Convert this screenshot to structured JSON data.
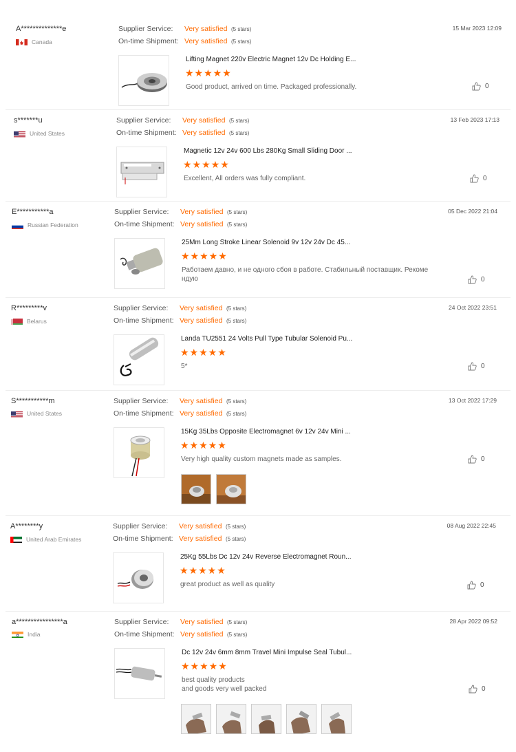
{
  "labels": {
    "supplier": "Supplier Service:",
    "shipment": "On-time Shipment:"
  },
  "reviews": [
    {
      "user": "A**************e",
      "country": "Canada",
      "supplier_val": "Very satisfied",
      "supplier_stars": "(5 stars)",
      "shipment_val": "Very satisfied",
      "shipment_stars": "(5 stars)",
      "date": "15 Mar 2023 12:09",
      "title": "Lifting Magnet 220v Electric Magnet 12v Dc Holding E...",
      "stars": "★★★★★",
      "feedback": "Good product, arrived on time. Packaged professionally.",
      "likes": "0"
    },
    {
      "user": "s*******u",
      "country": "United States",
      "supplier_val": "Very satisfied",
      "supplier_stars": "(5 stars)",
      "shipment_val": "Very satisfied",
      "shipment_stars": "(5 stars)",
      "date": "13 Feb 2023 17:13",
      "title": "Magnetic 12v 24v 600 Lbs 280Kg Small Sliding Door ...",
      "stars": "★★★★★",
      "feedback": "Excellent, All orders was fully compliant.",
      "likes": "0"
    },
    {
      "user": "E***********a",
      "country": "Russian Federation",
      "supplier_val": "Very satisfied",
      "supplier_stars": "(5 stars)",
      "shipment_val": "Very satisfied",
      "shipment_stars": "(5 stars)",
      "date": "05 Dec 2022 21:04",
      "title": "25Mm Long Stroke Linear Solenoid 9v 12v 24v Dc 45...",
      "stars": "★★★★★",
      "feedback": "Работаем давно, и не одного сбоя в работе. Стабильный поставщик. Рекоме ндую",
      "likes": "0"
    },
    {
      "user": "R*********v",
      "country": "Belarus",
      "supplier_val": "Very satisfied",
      "supplier_stars": "(5 stars)",
      "shipment_val": "Very satisfied",
      "shipment_stars": "(5 stars)",
      "date": "24 Oct 2022 23:51",
      "title": "Landa TU2551 24 Volts Pull Type Tubular Solenoid Pu...",
      "stars": "★★★★★",
      "feedback": "5*",
      "likes": "0"
    },
    {
      "user": "S***********m",
      "country": "United States",
      "supplier_val": "Very satisfied",
      "supplier_stars": "(5 stars)",
      "shipment_val": "Very satisfied",
      "shipment_stars": "(5 stars)",
      "date": "13 Oct 2022 17:29",
      "title": "15Kg 35Lbs Opposite Electromagnet 6v 12v 24v Mini ...",
      "stars": "★★★★★",
      "feedback": "Very high quality custom magnets made as samples.",
      "likes": "0"
    },
    {
      "user": "A********y",
      "country": "United Arab Emirates",
      "supplier_val": "Very satisfied",
      "supplier_stars": "(5 stars)",
      "shipment_val": "Very satisfied",
      "shipment_stars": "(5 stars)",
      "date": "08 Aug 2022 22:45",
      "title": "25Kg 55Lbs Dc 12v 24v Reverse Electromagnet Roun...",
      "stars": "★★★★★",
      "feedback": "great product as well as quality",
      "likes": "0"
    },
    {
      "user": "a****************a",
      "country": "India",
      "supplier_val": "Very satisfied",
      "supplier_stars": "(5 stars)",
      "shipment_val": "Very satisfied",
      "shipment_stars": "(5 stars)",
      "date": "28 Apr 2022 09:52",
      "title": "Dc 12v 24v 6mm 8mm Travel Mini Impulse Seal Tubul...",
      "stars": "★★★★★",
      "feedback": "best quality products\nand goods very well packed",
      "likes": "0"
    }
  ],
  "icons": {
    "like": "thumbs-up-icon",
    "star": "star-icon"
  },
  "colors": {
    "accent": "#ff6a00",
    "text": "#333333",
    "muted": "#888888"
  }
}
